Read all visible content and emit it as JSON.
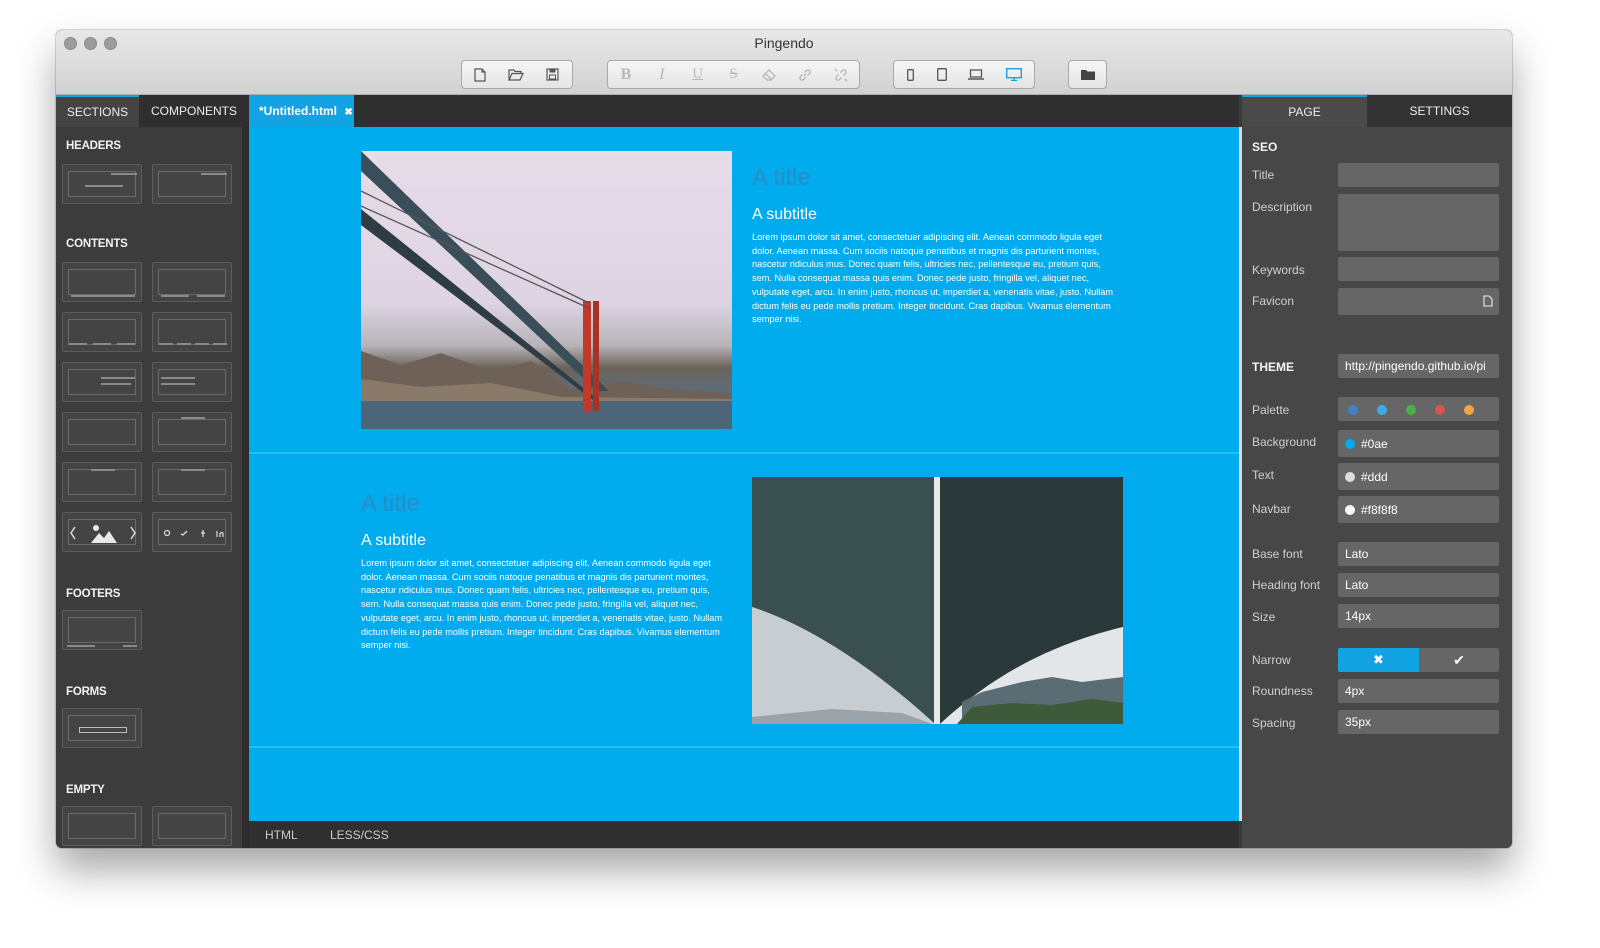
{
  "window": {
    "title": "Pingendo"
  },
  "toolbar": {
    "file_icons": [
      "new-file-icon",
      "open-folder-icon",
      "save-icon"
    ],
    "format_icons": [
      "bold-icon",
      "italic-icon",
      "underline-icon",
      "strikethrough-icon",
      "eraser-icon",
      "link-icon",
      "unlink-icon"
    ],
    "format_glyphs": [
      "B",
      "I",
      "U",
      "S"
    ],
    "device_icons": [
      "phone-icon",
      "tablet-icon",
      "laptop-icon",
      "desktop-icon"
    ],
    "active_device": "desktop",
    "folder_icon": "folder-icon"
  },
  "left_panel": {
    "tabs": [
      "SECTIONS",
      "COMPONENTS"
    ],
    "active_tab": "SECTIONS",
    "categories": [
      "HEADERS",
      "CONTENTS",
      "FOOTERS",
      "FORMS",
      "EMPTY"
    ],
    "social_icons": [
      "github-icon",
      "twitter-icon",
      "facebook-icon",
      "linkedin-icon"
    ]
  },
  "editor": {
    "file_tab": "*Untitled.html",
    "close_glyph": "✖",
    "sections": [
      {
        "title": "A title",
        "subtitle": "A subtitle",
        "body": "Lorem ipsum dolor sit amet, consectetuer adipiscing elit. Aenean commodo ligula eget dolor. Aenean massa. Cum sociis natoque penatibus et magnis dis parturient montes, nascetur ridiculus mus. Donec quam felis, ultricies nec, pellentesque eu, pretium quis, sem. Nulla consequat massa quis enim. Donec pede justo, fringilla vel, aliquet nec, vulputate eget, arcu. In enim justo, rhoncus ut, imperdiet a, venenatis vitae, justo. Nullam dictum felis eu pede mollis pretium. Integer tincidunt. Cras dapibus. Vivamus elementum semper nisi.",
        "image": "golden-gate-bridge-photo"
      },
      {
        "title": "A title",
        "subtitle": "A subtitle",
        "body": "Lorem ipsum dolor sit amet, consectetuer adipiscing elit. Aenean commodo ligula eget dolor. Aenean massa. Cum sociis natoque penatibus et magnis dis parturient montes, nascetur ridiculus mus. Donec quam felis, ultricies nec, pellentesque eu, pretium quis, sem. Nulla consequat massa quis enim. Donec pede justo, fringilla vel, aliquet nec, vulputate eget, arcu. In enim justo, rhoncus ut, imperdiet a, venenatis vitae, justo. Nullam dictum felis eu pede mollis pretium. Integer tincidunt. Cras dapibus. Vivamus elementum semper nisi.",
        "image": "under-bridge-photo"
      }
    ],
    "bottom_tabs": [
      "HTML",
      "LESS/CSS"
    ]
  },
  "right_panel": {
    "tabs": [
      "PAGE",
      "SETTINGS"
    ],
    "active_tab": "PAGE",
    "seo": {
      "heading": "SEO",
      "title_label": "Title",
      "title_value": "",
      "description_label": "Description",
      "description_value": "",
      "keywords_label": "Keywords",
      "keywords_value": "",
      "favicon_label": "Favicon",
      "favicon_value": ""
    },
    "theme": {
      "heading": "THEME",
      "url": "http://pingendo.github.io/pi",
      "palette_label": "Palette",
      "palette": [
        "#3d82c4",
        "#3fa9e8",
        "#4cae4c",
        "#d9534f",
        "#f0a742"
      ],
      "background_label": "Background",
      "background_value": "#0ae",
      "background_color": "#00aaee",
      "text_label": "Text",
      "text_value": "#ddd",
      "text_color": "#dddddd",
      "navbar_label": "Navbar",
      "navbar_value": "#f8f8f8",
      "navbar_color": "#f8f8f8",
      "base_font_label": "Base font",
      "base_font_value": "Lato",
      "heading_font_label": "Heading font",
      "heading_font_value": "Lato",
      "size_label": "Size",
      "size_value": "14px",
      "narrow_label": "Narrow",
      "narrow_off": "✖",
      "narrow_on": "✔",
      "roundness_label": "Roundness",
      "roundness_value": "4px",
      "spacing_label": "Spacing",
      "spacing_value": "35px"
    }
  },
  "colors": {
    "accent": "#12a3e3",
    "canvas": "#00acee",
    "title_text": "#2b8bc6"
  }
}
